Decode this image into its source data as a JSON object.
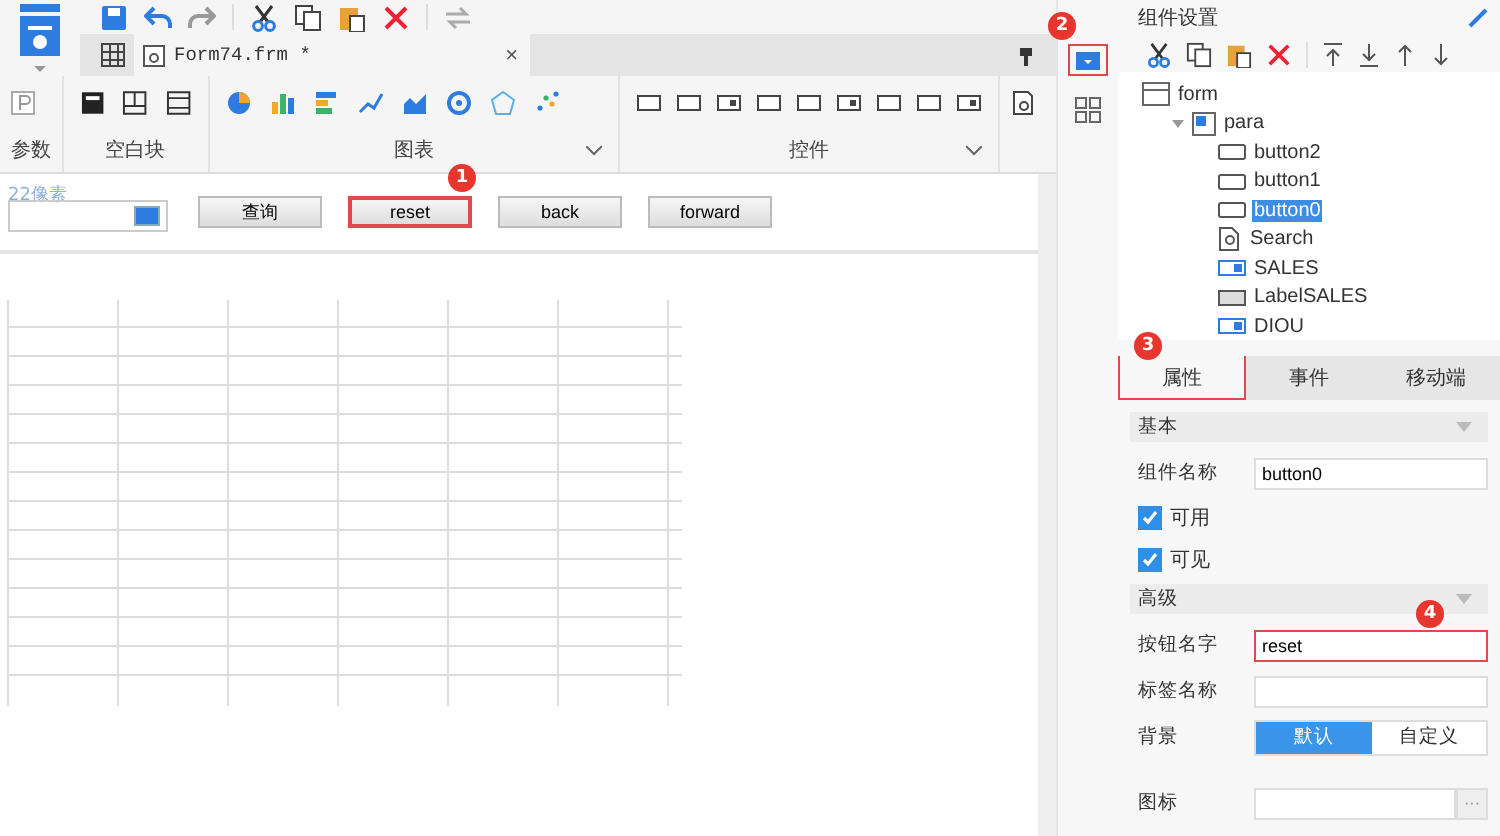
{
  "document_tab": {
    "title": "Form74.frm *",
    "close": "×"
  },
  "ribbon_groups": [
    {
      "kind": "param",
      "label": "参数"
    },
    {
      "kind": "blank",
      "label": "空白块"
    },
    {
      "kind": "chart",
      "label": "图表"
    },
    {
      "kind": "control",
      "label": "控件"
    }
  ],
  "parameter_pane": {
    "hint": "22像素",
    "buttons": [
      {
        "label": "查询",
        "highlighted": false
      },
      {
        "label": "reset",
        "highlighted": true,
        "badge": "1"
      },
      {
        "label": "back",
        "highlighted": false
      },
      {
        "label": "forward",
        "highlighted": false
      }
    ]
  },
  "side_strip": {
    "highlighted": true,
    "badge": "2"
  },
  "panel": {
    "title": "组件设置",
    "tree": [
      {
        "label": "form",
        "kind": "form",
        "selected": false,
        "children": [
          {
            "label": "para",
            "kind": "para",
            "selected": false,
            "expanded": true,
            "children": [
              {
                "label": "button2",
                "kind": "button",
                "selected": false
              },
              {
                "label": "button1",
                "kind": "button",
                "selected": false
              },
              {
                "label": "button0",
                "kind": "button",
                "selected": true
              },
              {
                "label": "Search",
                "kind": "search",
                "selected": false
              },
              {
                "label": "SALES",
                "kind": "combo",
                "selected": false
              },
              {
                "label": "LabelSALES",
                "kind": "label",
                "selected": false
              },
              {
                "label": "DIOU",
                "kind": "combo",
                "selected": false
              }
            ]
          }
        ]
      }
    ],
    "tabs": [
      {
        "label": "属性",
        "selected": true,
        "badge": "3"
      },
      {
        "label": "事件",
        "selected": false
      },
      {
        "label": "移动端",
        "selected": false
      }
    ],
    "sections": [
      {
        "title": "基本",
        "rows": [
          {
            "kind": "field",
            "label": "组件名称",
            "value": "button0",
            "highlighted": false
          },
          {
            "kind": "checkbox",
            "label": "可用",
            "checked": true
          },
          {
            "kind": "checkbox",
            "label": "可见",
            "checked": true
          }
        ]
      },
      {
        "title": "高级",
        "rows": [
          {
            "kind": "field",
            "label": "按钮名字",
            "value": "reset",
            "highlighted": true,
            "badge": "4"
          },
          {
            "kind": "field",
            "label": "标签名称",
            "highlighted": false
          },
          {
            "kind": "segmented",
            "label": "背景",
            "options": [
              {
                "label": "默认",
                "selected": true
              },
              {
                "label": "自定义",
                "selected": false
              }
            ]
          },
          {
            "kind": "picker",
            "label": "图标",
            "button": "···"
          }
        ]
      }
    ]
  }
}
